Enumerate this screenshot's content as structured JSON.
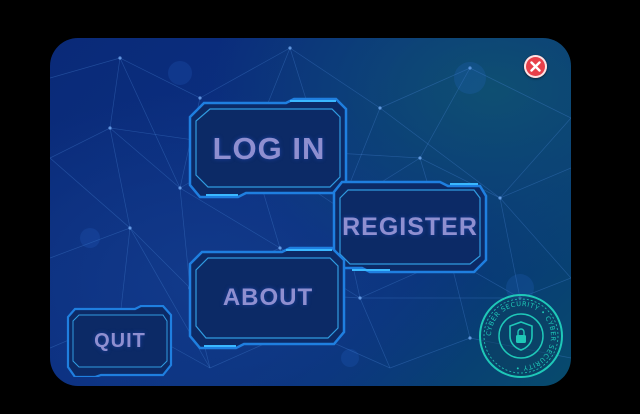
{
  "menu": {
    "login_label": "LOG IN",
    "register_label": "REGISTER",
    "about_label": "ABOUT",
    "quit_label": "QUIT"
  },
  "seal": {
    "text": "CYBER SECURITY • CYBER SECURITY •"
  },
  "colors": {
    "frame": "#1f7fe0",
    "frame_glow": "#3ab8ff",
    "button_fill": "#0c2a66",
    "label": "#8f8fd0",
    "close": "#e8404a",
    "seal": "#1fc8b8"
  },
  "icons": {
    "close": "close-icon",
    "seal": "shield-lock-icon"
  }
}
